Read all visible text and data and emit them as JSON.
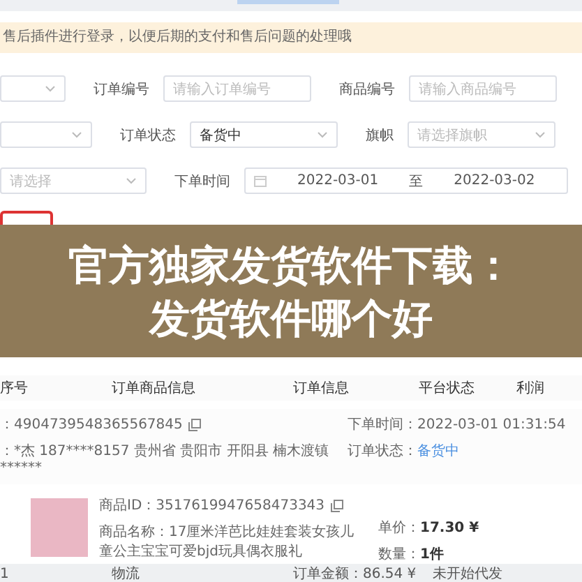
{
  "notice": "售后插件进行登录，以便后期的支付和售后问题的处理哦",
  "filters": [
    {
      "items": [
        {
          "kind": "select"
        },
        {
          "kind": "label",
          "text": "订单编号"
        },
        {
          "kind": "input",
          "placeholder": "请输入订单编号"
        },
        {
          "kind": "label",
          "text": "商品编号"
        },
        {
          "kind": "input",
          "placeholder": "请输入商品编号"
        }
      ]
    },
    {
      "items": [
        {
          "kind": "select"
        },
        {
          "kind": "label",
          "text": "订单状态"
        },
        {
          "kind": "select",
          "value": "备货中"
        },
        {
          "kind": "label",
          "text": "旗帜"
        },
        {
          "kind": "select",
          "placeholder": "请选择旗帜"
        }
      ]
    },
    {
      "items": [
        {
          "kind": "select",
          "placeholder": "请选择"
        },
        {
          "kind": "label",
          "text": "下单时间"
        },
        {
          "kind": "daterange",
          "start": "2022-03-01",
          "separator": "至",
          "end": "2022-03-02"
        }
      ]
    }
  ],
  "table": {
    "columns": [
      "序号",
      "订单商品信息",
      "订单信息",
      "平台状态",
      "利润"
    ],
    "order": {
      "order_no": "：4904739548365567845",
      "buyer": "：*杰  187****8157  贵州省 贵阳市 开阳县 楠木渡镇  ******",
      "order_time": "下单时间：2022-03-01 01:31:54",
      "status_label": "订单状态：",
      "status": "备货中"
    },
    "product": {
      "id": "商品ID：3517619947658473343",
      "name": "商品名称：17厘米洋芭比娃娃套装女孩儿童公主宝宝可爱bjd玩具偶衣服礼",
      "price_label": "单价：",
      "price": "17.30 ¥",
      "qty_label": "数量：",
      "qty": "1件"
    },
    "footer": {
      "index": "1",
      "logistics": "物流",
      "amount": "订单金额：86.54 ¥",
      "status": "未开始代发"
    }
  },
  "overlay_title": [
    "官方独家发货软件下载：",
    "发货软件哪个好"
  ]
}
